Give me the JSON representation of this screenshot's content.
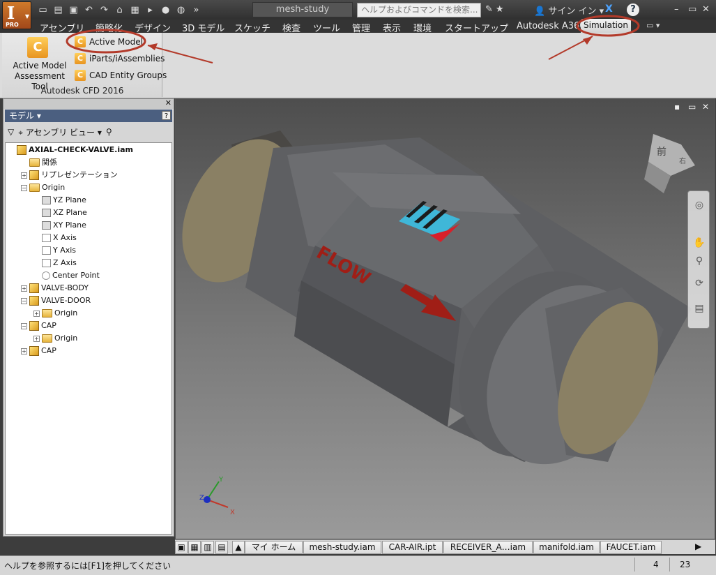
{
  "window": {
    "doc_title": "mesh-study",
    "search_placeholder": "ヘルプおよびコマンドを検索...",
    "signin": "サイン イン",
    "help": "?",
    "app_logo": "I",
    "app_edition": "PRO",
    "minimize": "–",
    "restore": "▭",
    "close": "✕"
  },
  "tabs": [
    "アセンブリ",
    "簡略化",
    "デザイン",
    "3D モデル",
    "スケッチ",
    "検査",
    "ツール",
    "管理",
    "表示",
    "環境",
    "スタートアップ",
    "Autodesk A360",
    "Simulation"
  ],
  "ribbon": {
    "big_button": "Active Model Assessment Tool",
    "big_button_line1": "Active Model",
    "big_button_line2": "Assessment Tool",
    "small_buttons": [
      "Active Model",
      "iParts/iAssemblies",
      "CAD Entity Groups"
    ],
    "group_label": "Autodesk CFD 2016"
  },
  "browser": {
    "header": "モデル ▾",
    "view_label": "アセンブリ ビュー",
    "tree": [
      {
        "label": "AXIAL-CHECK-VALVE.iam",
        "level": 0,
        "icon": "assembly-icon",
        "expander": "",
        "bold": true
      },
      {
        "label": "関係",
        "level": 1,
        "icon": "folder-icon",
        "expander": ""
      },
      {
        "label": "リプレゼンテーション",
        "level": 1,
        "icon": "representation-icon",
        "expander": "+"
      },
      {
        "label": "Origin",
        "level": 1,
        "icon": "folder-open-icon",
        "expander": "−"
      },
      {
        "label": "YZ Plane",
        "level": 2,
        "icon": "plane-icon",
        "expander": ""
      },
      {
        "label": "XZ Plane",
        "level": 2,
        "icon": "plane-icon",
        "expander": ""
      },
      {
        "label": "XY Plane",
        "level": 2,
        "icon": "plane-icon",
        "expander": ""
      },
      {
        "label": "X Axis",
        "level": 2,
        "icon": "axis-icon",
        "expander": ""
      },
      {
        "label": "Y Axis",
        "level": 2,
        "icon": "axis-icon",
        "expander": ""
      },
      {
        "label": "Z Axis",
        "level": 2,
        "icon": "axis-icon",
        "expander": ""
      },
      {
        "label": "Center Point",
        "level": 2,
        "icon": "point-icon",
        "expander": ""
      },
      {
        "label": "VALVE-BODY",
        "level": 1,
        "icon": "part-icon",
        "expander": "+"
      },
      {
        "label": "VALVE-DOOR",
        "level": 1,
        "icon": "part-icon",
        "expander": "−"
      },
      {
        "label": "Origin",
        "level": 2,
        "icon": "folder-icon",
        "expander": "+"
      },
      {
        "label": "CAP",
        "level": 1,
        "icon": "part-icon",
        "expander": "−"
      },
      {
        "label": "Origin",
        "level": 2,
        "icon": "folder-icon",
        "expander": "+"
      },
      {
        "label": "CAP",
        "level": 1,
        "icon": "part-icon",
        "expander": "+"
      }
    ]
  },
  "viewport": {
    "viewcube_face": "前",
    "viewcube_side": "右",
    "flow_label": "FLOW",
    "axis_x": "X",
    "axis_y": "Y",
    "axis_z": "Z"
  },
  "doc_tabs": [
    "マイ ホーム",
    "mesh-study.iam",
    "CAR-AIR.ipt",
    "RECEIVER_A…iam",
    "manifold.iam",
    "FAUCET.iam"
  ],
  "status": {
    "message": "ヘルプを参照するには[F1]を押してください",
    "count1": "4",
    "count2": "23"
  },
  "colors": {
    "model_body": "#6c6d70",
    "model_cap": "#8a8064",
    "flow_arrow": "#a01e16",
    "annotation": "#b33a2a",
    "logo_cyan": "#3fb7d8",
    "logo_red": "#d8202a"
  }
}
